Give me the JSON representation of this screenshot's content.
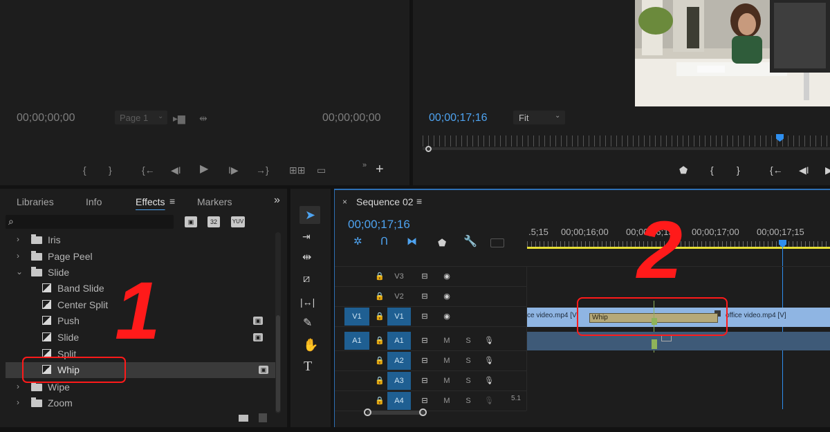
{
  "source_monitor": {
    "timecode_in": "00;00;00;00",
    "page_select": "Page 1",
    "timecode_out": "00;00;00;00"
  },
  "program_monitor": {
    "timecode": "00;00;17;16",
    "fit": "Fit"
  },
  "effects_panel": {
    "tabs": [
      "Libraries",
      "Info",
      "Effects",
      "Markers"
    ],
    "search_badges": [
      "32",
      "YUV"
    ],
    "tree": [
      {
        "label": "Iris",
        "type": "folder",
        "expanded": false
      },
      {
        "label": "Page Peel",
        "type": "folder",
        "expanded": false
      },
      {
        "label": "Slide",
        "type": "folder",
        "expanded": true
      },
      {
        "label": "Band Slide",
        "type": "effect"
      },
      {
        "label": "Center Split",
        "type": "effect"
      },
      {
        "label": "Push",
        "type": "effect"
      },
      {
        "label": "Slide",
        "type": "effect"
      },
      {
        "label": "Split",
        "type": "effect"
      },
      {
        "label": "Whip",
        "type": "effect",
        "selected": true
      },
      {
        "label": "Wipe",
        "type": "folder",
        "expanded": false
      },
      {
        "label": "Zoom",
        "type": "folder",
        "expanded": false
      }
    ]
  },
  "annotations": {
    "one": "1",
    "two": "2"
  },
  "sequence": {
    "tab_label": "Sequence 02",
    "close": "×",
    "timecode": "00;00;17;16",
    "ruler": [
      ".5;15",
      "00;00;16;00",
      "00;00;16;15",
      "00;00;17;00",
      "00;00;17;15"
    ],
    "tracks": [
      {
        "name": "V3"
      },
      {
        "name": "V2"
      },
      {
        "name": "V1",
        "target": "V1"
      },
      {
        "name": "A1",
        "target": "A1",
        "m": "M",
        "s": "S"
      },
      {
        "name": "A2",
        "m": "M",
        "s": "S"
      },
      {
        "name": "A3",
        "m": "M",
        "s": "S"
      },
      {
        "name": "A4",
        "m": "M",
        "s": "S",
        "extra": "5.1"
      }
    ],
    "clip_left": "ce video.mp4 [V]",
    "clip_right": "office video.mp4 [V]",
    "transition": "Whip"
  },
  "colors": {
    "accent": "#4ea3f0",
    "annotation": "#ff1a1a",
    "playhead": "#2f8fef",
    "work_area": "#e6df35"
  }
}
